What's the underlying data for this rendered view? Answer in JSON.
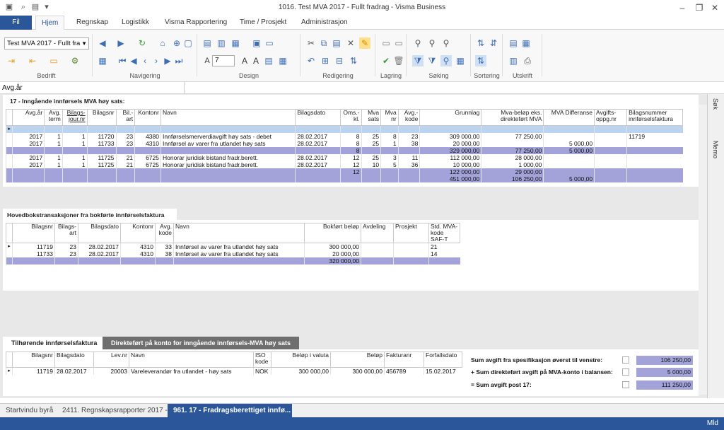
{
  "window": {
    "title": "1016. Test MVA 2017 - Fullt fradrag - Visma Business"
  },
  "menu": {
    "file": "Fil",
    "tabs": [
      "Hjem",
      "Regnskap",
      "Logistikk",
      "Visma Rapportering",
      "Time / Prosjekt",
      "Administrasjon"
    ]
  },
  "ribbon": {
    "combo": "Test MVA 2017 - Fullt fra",
    "number": "7",
    "groups": [
      "Bedrift",
      "Navigering",
      "Design",
      "Redigering",
      "Lagring",
      "Søking",
      "Sortering",
      "Utskrift"
    ]
  },
  "avg": {
    "label": "Avg.år"
  },
  "section1": {
    "title": "17 - Inngående innførsels MVA høy sats:",
    "headers": [
      "Avg.år",
      "Avg. term",
      "Bilags-jour.nr",
      "Bilagsnr",
      "Bil.-art",
      "Kontonr",
      "Navn",
      "Bilagsdato",
      "Oms.-kl.",
      "Mva sats",
      "Mva nr",
      "Avg.-kode",
      "Grunnlag",
      "Mva-beløp eks. direkteført MVA",
      "MVA Differanse",
      "Avgifts-oppg.nr",
      "Bilagsnummer innførselsfaktura"
    ],
    "rows": [
      {
        "type": "sel",
        "cells": [
          "",
          "",
          "",
          "",
          "",
          "",
          "",
          "",
          "",
          "",
          "",
          "",
          "",
          "",
          "",
          "",
          ""
        ]
      },
      {
        "type": "data",
        "cells": [
          "2017",
          "1",
          "1",
          "11720",
          "23",
          "4380",
          "Innførselsmerverdiavgift høy sats - debet",
          "28.02.2017",
          "8",
          "25",
          "8",
          "23",
          "309 000,00",
          "77 250,00",
          "",
          "",
          "11719"
        ]
      },
      {
        "type": "data",
        "cells": [
          "2017",
          "1",
          "1",
          "11733",
          "23",
          "4310",
          "Innførsel av varer fra utlandet høy sats",
          "28.02.2017",
          "8",
          "25",
          "1",
          "38",
          "20 000,00",
          "",
          "5 000,00",
          "",
          ""
        ]
      },
      {
        "type": "sum",
        "cells": [
          "",
          "",
          "",
          "",
          "",
          "",
          "",
          "",
          "8",
          "",
          "",
          "",
          "329 000,00",
          "77 250,00",
          "5 000,00",
          "",
          ""
        ]
      },
      {
        "type": "data",
        "cells": [
          "2017",
          "1",
          "1",
          "11725",
          "21",
          "6725",
          "Honorar juridisk bistand fradr.berett.",
          "28.02.2017",
          "12",
          "25",
          "3",
          "11",
          "112 000,00",
          "28 000,00",
          "",
          "",
          ""
        ]
      },
      {
        "type": "data",
        "cells": [
          "2017",
          "1",
          "1",
          "11725",
          "21",
          "6725",
          "Honorar juridisk bistand fradr.berett.",
          "28.02.2017",
          "12",
          "10",
          "5",
          "36",
          "10 000,00",
          "1 000,00",
          "",
          "",
          ""
        ]
      },
      {
        "type": "sum",
        "cells": [
          "",
          "",
          "",
          "",
          "",
          "",
          "",
          "",
          "12",
          "",
          "",
          "",
          "122 000,00",
          "29 000,00",
          "",
          "",
          ""
        ]
      },
      {
        "type": "sum",
        "cells": [
          "",
          "",
          "",
          "",
          "",
          "",
          "",
          "",
          "",
          "",
          "",
          "",
          "451 000,00",
          "106 250,00",
          "5 000,00",
          "",
          ""
        ]
      }
    ]
  },
  "section2": {
    "title": "Hovedbokstransaksjoner fra bokførte innførselsfaktura",
    "headers": [
      "Bilagsnr",
      "Bilags-art",
      "Bilagsdato",
      "Kontonr",
      "Avg. kode",
      "Navn",
      "Bokført beløp",
      "Avdeling",
      "Prosjekt",
      "Std. MVA-kode SAF-T"
    ],
    "rows": [
      {
        "type": "data",
        "cells": [
          "11719",
          "23",
          "28.02.2017",
          "4310",
          "33",
          "Innførsel av varer fra utlandet høy sats",
          "300 000,00",
          "",
          "",
          "21"
        ]
      },
      {
        "type": "data",
        "cells": [
          "11733",
          "23",
          "28.02.2017",
          "4310",
          "38",
          "Innførsel av varer fra utlandet høy sats",
          "20 000,00",
          "",
          "",
          "14"
        ]
      },
      {
        "type": "sum",
        "cells": [
          "",
          "",
          "",
          "",
          "",
          "",
          "320 000,00",
          "",
          "",
          ""
        ]
      }
    ]
  },
  "section3": {
    "tabs": [
      "Tilhørende innførselsfaktura",
      "Direkteført på konto for inngående innførsels-MVA høy sats"
    ],
    "headers": [
      "Bilagsnr",
      "Bilagsdato",
      "Lev.nr",
      "Navn",
      "ISO kode",
      "Beløp i valuta",
      "Beløp",
      "Fakturanr",
      "Forfallsdato"
    ],
    "rows": [
      {
        "type": "data",
        "cells": [
          "11719",
          "28.02.2017",
          "20003",
          "Vareleverandør fra utlandet - høy sats",
          "NOK",
          "300 000,00",
          "300 000,00",
          "456789",
          "15.02.2017"
        ]
      }
    ]
  },
  "summary": [
    {
      "label": "Sum avgift fra spesifikasjon øverst til venstre:",
      "value": "106 250,00"
    },
    {
      "label": "+ Sum direkteført avgift på MVA-konto i balansen:",
      "value": "5 000,00"
    },
    {
      "label": "= Sum avgift post 17:",
      "value": "111 250,00"
    }
  ],
  "rightpanel": {
    "sok": "Søk",
    "memo": "Memo"
  },
  "taskbar": [
    "Startvindu byrå",
    "2411. Regnskapsrapporter 2017 ->",
    "961. 17 - Fradragsberettiget innfø..."
  ],
  "status": "Mld",
  "colors": {
    "brand": "#2b579a",
    "sum": "#a3a3d9",
    "selected": "#bcd3f0"
  }
}
